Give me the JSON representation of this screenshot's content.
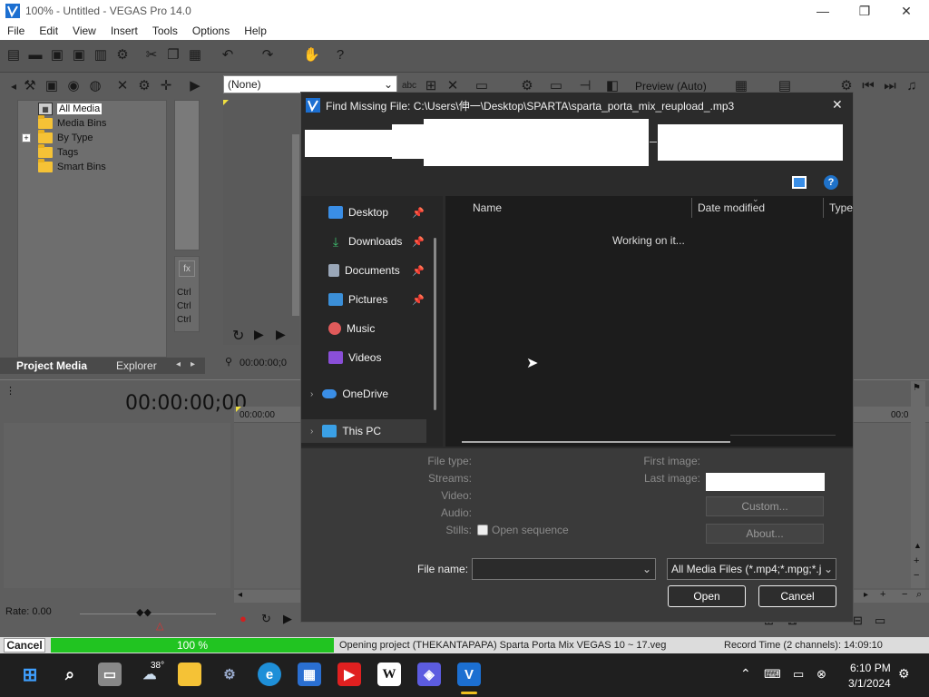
{
  "window": {
    "title": "100% - Untitled - VEGAS Pro 14.0",
    "minimize": "—",
    "restore": "❐",
    "close": "✕"
  },
  "menu": [
    "File",
    "Edit",
    "View",
    "Insert",
    "Tools",
    "Options",
    "Help"
  ],
  "toolbar": {
    "preset_value": "(None)",
    "preview_label": "Preview (Auto)"
  },
  "media_tree": {
    "items": [
      "All Media",
      "Media Bins",
      "By Type",
      "Tags",
      "Smart Bins"
    ]
  },
  "tabs": [
    "Project Media",
    "Explorer"
  ],
  "trimmer": {
    "ctrl_labels": [
      "Ctrl",
      "Ctrl",
      "Ctrl"
    ],
    "timecode": "00:00:00;0"
  },
  "timeline": {
    "timecode": "00:00:00;00",
    "ruler_start": "00:00:00",
    "ruler_end": "00:0",
    "rate": "Rate: 0.00"
  },
  "status": {
    "cancel": "Cancel",
    "progress_text": "100 %",
    "progress_pct": 100,
    "message": "Opening project (THEKANTAPAPA) Sparta Porta Mix VEGAS 10 ~ 17.veg",
    "record_time": "Record Time (2 channels): 14:09:10"
  },
  "dialog": {
    "title": "Find Missing File: C:\\Users\\伸一\\Desktop\\SPARTA\\sparta_porta_mix_reupload_.mp3",
    "close": "✕",
    "help": "?",
    "sidebar": [
      {
        "label": "Desktop",
        "icon": "desktop-icon",
        "color": "#3a8ee6",
        "pinned": true
      },
      {
        "label": "Downloads",
        "icon": "download-icon",
        "color": "#3fbf6f",
        "pinned": true
      },
      {
        "label": "Documents",
        "icon": "document-icon",
        "color": "#9aa7b8",
        "pinned": true
      },
      {
        "label": "Pictures",
        "icon": "picture-icon",
        "color": "#3b8fd8",
        "pinned": true
      },
      {
        "label": "Music",
        "icon": "music-icon",
        "color": "#e05a5a",
        "pinned": false
      },
      {
        "label": "Videos",
        "icon": "video-icon",
        "color": "#8a4fd8",
        "pinned": false
      }
    ],
    "onedrive": "OneDrive",
    "thispc": "This PC",
    "columns": [
      "Name",
      "Date modified",
      "Type"
    ],
    "working": "Working on it...",
    "info_labels": {
      "file_type": "File type:",
      "streams": "Streams:",
      "video": "Video:",
      "audio": "Audio:",
      "stills": "Stills:",
      "open_sequence": "Open sequence",
      "first_image": "First image:",
      "last_image": "Last image:"
    },
    "custom_button": "Custom...",
    "about_button": "About...",
    "file_name_label": "File name:",
    "file_name_value": "",
    "filter_value": "All Media Files (*.mp4;*.mpg;*.j",
    "open_button": "Open",
    "cancel_button": "Cancel"
  },
  "taskbar": {
    "weather_temp": "38°",
    "time": "6:10 PM",
    "date": "3/1/2024"
  }
}
